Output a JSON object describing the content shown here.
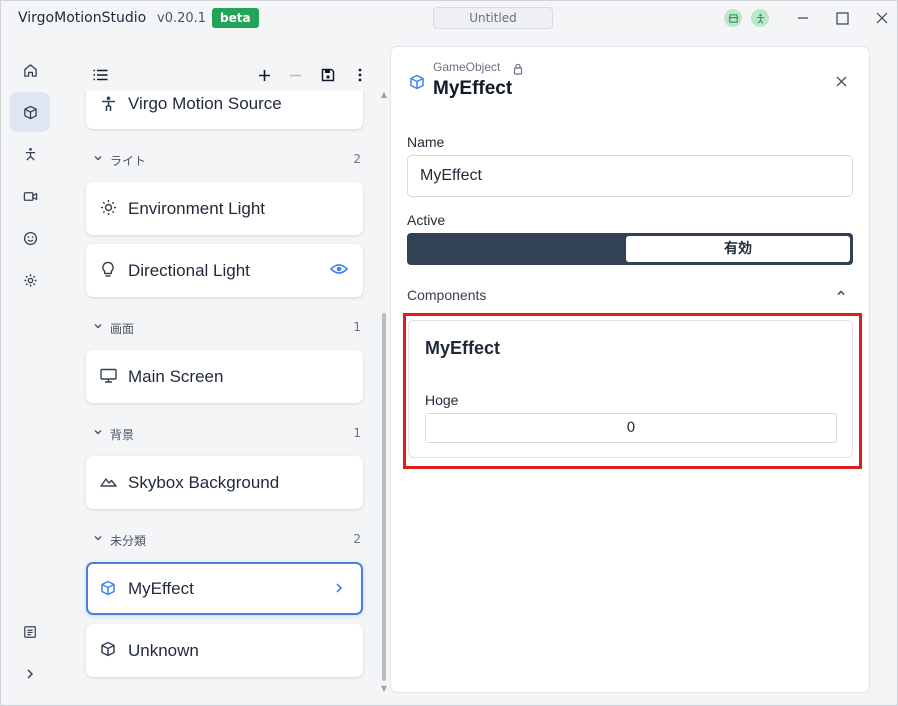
{
  "app": {
    "name": "VirgoMotionStudio",
    "version": "v0.20.1",
    "badge": "beta",
    "document_title": "Untitled"
  },
  "titlebar": {
    "status_icons": [
      "storefront-icon",
      "person-icon"
    ],
    "status_color": "#bfe6cb",
    "window_controls": [
      "minimize-icon",
      "maximize-icon",
      "close-icon"
    ]
  },
  "rail": {
    "items": [
      {
        "icon": "home-icon",
        "active": false
      },
      {
        "icon": "cube-icon",
        "active": true
      },
      {
        "icon": "skeleton-icon",
        "active": false
      },
      {
        "icon": "camera-icon",
        "active": false
      },
      {
        "icon": "face-icon",
        "active": false
      },
      {
        "icon": "settings-icon",
        "active": false
      }
    ],
    "bottom_items": [
      {
        "icon": "log-icon"
      },
      {
        "icon": "expand-icon"
      }
    ]
  },
  "scene_list": {
    "toolbar": [
      "list-icon",
      "add-icon",
      "remove-icon",
      "save-icon",
      "more-icon"
    ],
    "items": [
      {
        "label": "Virgo Motion Source",
        "icon": "figure-icon"
      },
      {
        "group": "ライト",
        "count": "2"
      },
      {
        "label": "Environment Light",
        "icon": "sun-icon"
      },
      {
        "label": "Directional Light",
        "icon": "bulb-icon",
        "trailing": "eye-icon"
      },
      {
        "group": "画面",
        "count": "1"
      },
      {
        "label": "Main Screen",
        "icon": "monitor-icon"
      },
      {
        "group": "背景",
        "count": "1"
      },
      {
        "label": "Skybox Background",
        "icon": "mountain-icon"
      },
      {
        "group": "未分類",
        "count": "2"
      },
      {
        "label": "MyEffect",
        "icon": "cube-icon",
        "selected": true,
        "trailing": "chevron-right-icon"
      },
      {
        "label": "Unknown",
        "icon": "cube-icon"
      }
    ]
  },
  "inspector": {
    "kind": "GameObject",
    "title": "MyEffect",
    "name_label": "Name",
    "name_value": "MyEffect",
    "active_label": "Active",
    "active_on_label": "有効",
    "components_label": "Components",
    "component": {
      "title": "MyEffect",
      "field_label": "Hoge",
      "field_value": "0"
    }
  },
  "colors": {
    "accent": "#3b82f6",
    "beta": "#22a55b",
    "toggle_bg": "#334155",
    "highlight": "#dc1f1f"
  }
}
